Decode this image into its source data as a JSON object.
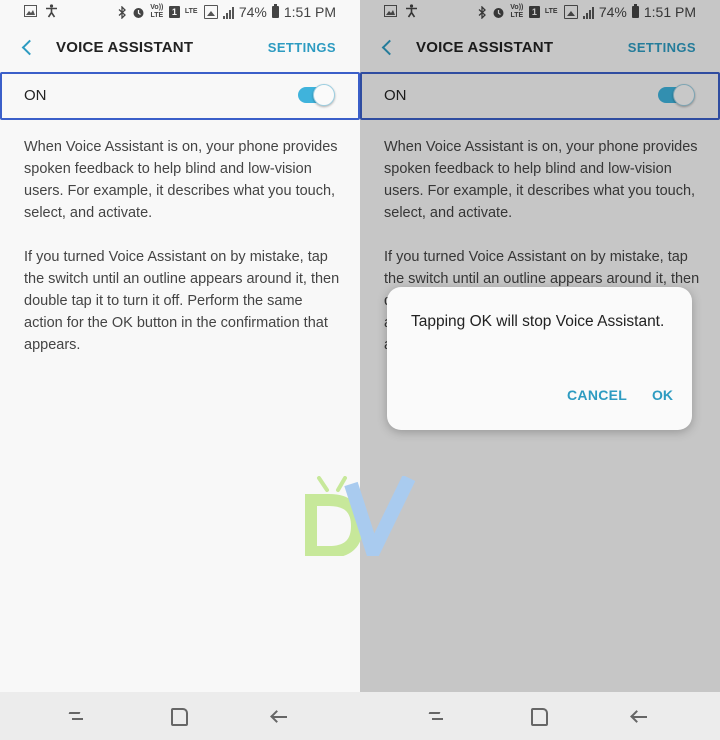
{
  "status_bar": {
    "battery_text": "74%",
    "time": "1:51 PM",
    "volte_label": "Vo)) LTE",
    "sim_label": "1",
    "lte_label": "LTE",
    "icons": [
      "image-icon",
      "accessibility-icon",
      "bluetooth-icon",
      "alarm-icon",
      "volte-icon",
      "sim-icon",
      "lte-signal-icon",
      "signal-icon",
      "battery-icon"
    ]
  },
  "header": {
    "title": "VOICE ASSISTANT",
    "settings_label": "SETTINGS",
    "back_icon": "chevron-left-icon"
  },
  "switch_row": {
    "label": "ON",
    "state": "on"
  },
  "description": {
    "paragraph_1": "When Voice Assistant is on, your phone provides spoken feedback to help blind and low-vision users. For example, it describes what you touch, select, and activate.",
    "paragraph_2": "If you turned Voice Assistant on by mistake, tap the switch until an outline appears around it, then double tap it to turn it off. Perform the same action for the OK button in the confirmation that appears."
  },
  "dialog": {
    "message": "Tapping OK will stop Voice Assistant.",
    "cancel_label": "CANCEL",
    "ok_label": "OK"
  },
  "nav_bar": {
    "icons": [
      "recent-apps-icon",
      "home-icon",
      "back-icon"
    ]
  },
  "colors": {
    "accent": "#2d9bc1",
    "toggle_on": "#3fb3dc",
    "focus_outline": "#3b5fc9",
    "watermark_green": "#c7e89a",
    "watermark_blue": "#a9cbef"
  }
}
